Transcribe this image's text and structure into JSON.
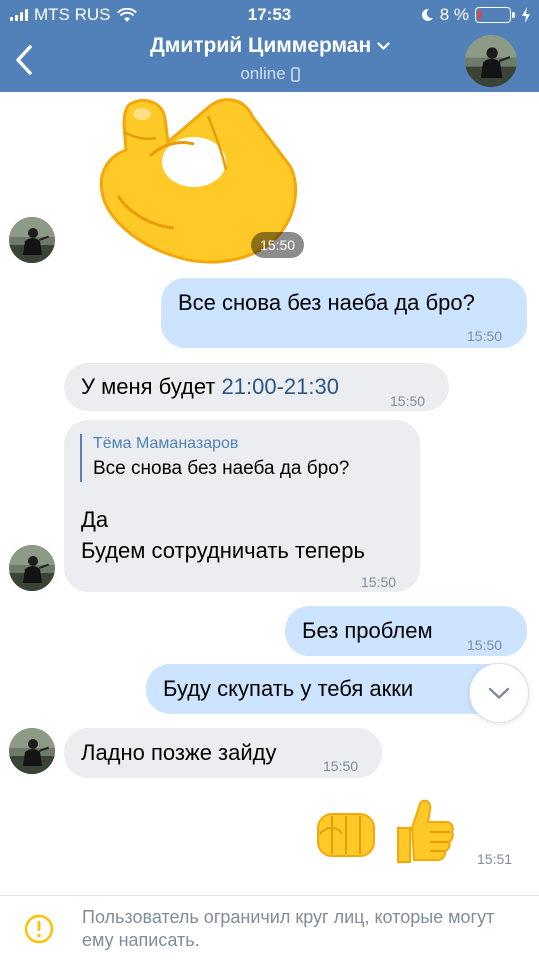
{
  "status_bar": {
    "carrier": "MTS RUS",
    "time": "17:53",
    "battery_percent": "8 %",
    "battery_level": 0.08,
    "icons": [
      "signal-bars",
      "wifi-icon",
      "moon-icon",
      "battery-icon",
      "charging-bolt-icon"
    ]
  },
  "header": {
    "title": "Дмитрий Циммерман",
    "subtitle": "online",
    "back_icon": "chevron-left-icon",
    "title_icon": "chevron-down-icon",
    "subtitle_icon": "mobile-phone-icon"
  },
  "messages": [
    {
      "id": "m1",
      "direction": "in",
      "type": "sticker",
      "sticker": "ok-hand-emoji",
      "time": "15:50"
    },
    {
      "id": "m2",
      "direction": "out",
      "text": "Все снова без наеба да бро?",
      "time": "15:50"
    },
    {
      "id": "m3",
      "direction": "in",
      "text_before": "У меня будет ",
      "link": "21:00-21:30",
      "time": "15:50"
    },
    {
      "id": "m4",
      "direction": "in",
      "reply": {
        "author": "Тёма Маманазаров",
        "text": "Все снова без наеба да бро?"
      },
      "lines": [
        "Да",
        "Будем сотрудничать теперь"
      ],
      "time": "15:50"
    },
    {
      "id": "m5",
      "direction": "out",
      "text": "Без проблем",
      "time": "15:50"
    },
    {
      "id": "m6",
      "direction": "out",
      "text": "Буду скупать у тебя акки"
    },
    {
      "id": "m7",
      "direction": "in",
      "text": "Ладно позже зайду",
      "time": "15:50"
    },
    {
      "id": "m8",
      "direction": "out",
      "type": "emoji",
      "emoji": [
        "fist-bump-emoji",
        "thumbs-up-emoji"
      ],
      "time": "15:51"
    }
  ],
  "scroll_down_icon": "chevron-down-icon",
  "footer": {
    "icon": "warning-circle-icon",
    "text": "Пользователь ограничил круг лиц, которые могут ему написать."
  },
  "colors": {
    "header": "#5181b8",
    "bubble_in": "#ebedf0",
    "bubble_out": "#cce4ff",
    "link": "#2a5885",
    "meta": "#818c99",
    "warning": "#ffc107",
    "emoji_yellow": "#ffca28"
  }
}
